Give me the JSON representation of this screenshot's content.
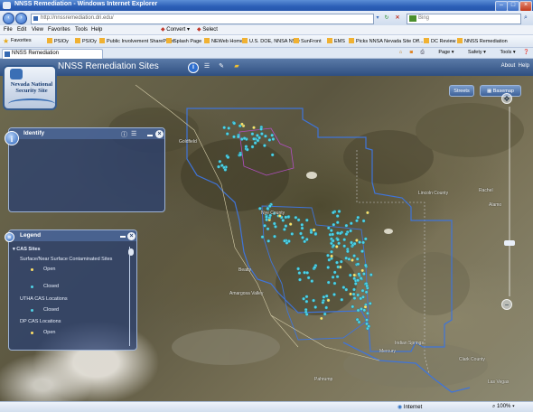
{
  "window": {
    "title": "NNSS Remediation - Windows Internet Explorer"
  },
  "address": {
    "url": "http://nnssremediation.dri.edu/",
    "search_placeholder": "Bing"
  },
  "menu": {
    "items": [
      "File",
      "Edit",
      "View",
      "Favorites",
      "Tools",
      "Help"
    ],
    "convert_label": "Convert",
    "select_label": "Select"
  },
  "favorites": {
    "label": "Favorites",
    "items": [
      "PSIOy",
      "PSIOy",
      "Public Involvement SharePoint",
      "Splash Page",
      "NEWeb Home",
      "U.S. DOE, NNSA NSO",
      "SunFront",
      "EMS",
      "Picks NNSA Nevada Site Off...",
      "DC Review",
      "NNSS Remediation"
    ]
  },
  "tab": {
    "label": "NNSS Remediation"
  },
  "commandbar": {
    "page": "Page",
    "safety": "Safety",
    "tools": "Tools"
  },
  "app": {
    "title": "NNSS Remediation Sites",
    "about": "About",
    "help": "Help",
    "logo_line1": "Nevada National",
    "logo_line2": "Security Site"
  },
  "map_buttons": {
    "basemap": "Basemap",
    "streets": "Streets"
  },
  "identify": {
    "title": "Identify"
  },
  "legend": {
    "title": "Legend",
    "group": "CAS Sites",
    "section1": "Surface/Near Surface Contaminated Sites",
    "open": "Open",
    "closed": "Closed",
    "section2": "UTHA CAS Locations",
    "closed2": "Closed",
    "section3": "DP CAS Locations",
    "open3": "Open",
    "colors": {
      "open": "#ffe066",
      "closed": "#4fd3e6"
    }
  },
  "map_labels": {
    "lincoln": "Lincoln County",
    "nye": "Nye County",
    "clark": "Clark County",
    "rachel": "Rachel",
    "alamo": "Alamo",
    "indian_springs": "Indian Springs",
    "beatty": "Beatty",
    "pahrump": "Pahrump",
    "amargosa": "Amargosa Valley",
    "mercury": "Mercury",
    "goldfield": "Goldfield",
    "las_vegas": "Las Vegas"
  },
  "status": {
    "zone": "Internet",
    "zoom": "100%"
  }
}
